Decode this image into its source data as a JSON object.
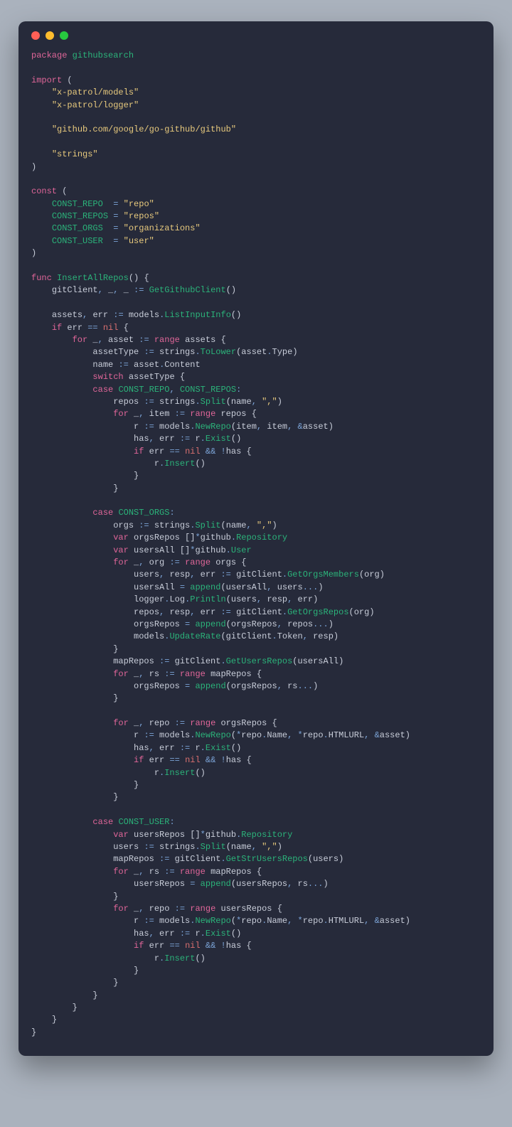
{
  "window": {
    "traffic_lights": [
      "red",
      "yellow",
      "green"
    ]
  },
  "code": {
    "language": "go",
    "package_name": "githubsearch",
    "imports": [
      "x-patrol/models",
      "x-patrol/logger",
      "github.com/google/go-github/github",
      "strings"
    ],
    "constants": {
      "CONST_REPO": "repo",
      "CONST_REPOS": "repos",
      "CONST_ORGS": "organizations",
      "CONST_USER": "user"
    },
    "function": {
      "name": "InsertAllRepos",
      "calls": [
        "GetGithubClient",
        "models.ListInputInfo",
        "strings.ToLower",
        "asset.Content",
        "strings.Split",
        "models.NewRepo",
        "r.Exist",
        "r.Insert",
        "gitClient.GetOrgsMembers",
        "append",
        "logger.Log.Println",
        "gitClient.GetOrgsRepos",
        "models.UpdateRate",
        "gitClient.GetUsersRepos",
        "gitClient.GetStrUsersRepos"
      ]
    },
    "tokens": {
      "kw_package": "package",
      "kw_import": "import",
      "kw_const": "const",
      "kw_func": "func",
      "kw_if": "if",
      "kw_for": "for",
      "kw_switch": "switch",
      "kw_case": "case",
      "kw_var": "var",
      "kw_range": "range",
      "kw_nil": "nil",
      "pkg_name": "githubsearch",
      "imp_models": "\"x-patrol/models\"",
      "imp_logger": "\"x-patrol/logger\"",
      "imp_github": "\"github.com/google/go-github/github\"",
      "imp_strings": "\"strings\"",
      "c_repo_name": "CONST_REPO",
      "c_repos_name": "CONST_REPOS",
      "c_orgs_name": "CONST_ORGS",
      "c_user_name": "CONST_USER",
      "c_repo_val": "\"repo\"",
      "c_repos_val": "\"repos\"",
      "c_orgs_val": "\"organizations\"",
      "c_user_val": "\"user\"",
      "fn_name": "InsertAllRepos",
      "id_gitClient": "gitClient",
      "fn_GetGithubClient": "GetGithubClient",
      "id_assets": "assets",
      "id_err": "err",
      "id_models": "models",
      "fn_ListInputInfo": "ListInputInfo",
      "id_asset": "asset",
      "id_assetType": "assetType",
      "id_strings": "strings",
      "fn_ToLower": "ToLower",
      "id_Type": "Type",
      "id_name": "name",
      "id_Content": "Content",
      "id_repos": "repos",
      "fn_Split": "Split",
      "str_comma": "\",\"",
      "id_item": "item",
      "id_r": "r",
      "fn_NewRepo": "NewRepo",
      "id_has": "has",
      "fn_Exist": "Exist",
      "fn_Insert": "Insert",
      "id_orgs": "orgs",
      "id_orgsRepos": "orgsRepos",
      "id_github": "github",
      "id_Repository": "Repository",
      "id_usersAll": "usersAll",
      "id_User": "User",
      "id_org": "org",
      "id_users": "users",
      "id_resp": "resp",
      "fn_GetOrgsMembers": "GetOrgsMembers",
      "fn_append": "append",
      "id_logger": "logger",
      "id_Log": "Log",
      "fn_Println": "Println",
      "fn_GetOrgsRepos": "GetOrgsRepos",
      "fn_UpdateRate": "UpdateRate",
      "id_Token": "Token",
      "id_mapRepos": "mapRepos",
      "fn_GetUsersRepos": "GetUsersRepos",
      "id_rs": "rs",
      "id_repo": "repo",
      "id_Name": "Name",
      "id_HTMLURL": "HTMLURL",
      "id_usersRepos": "usersRepos",
      "fn_GetStrUsersRepos": "GetStrUsersRepos"
    }
  }
}
